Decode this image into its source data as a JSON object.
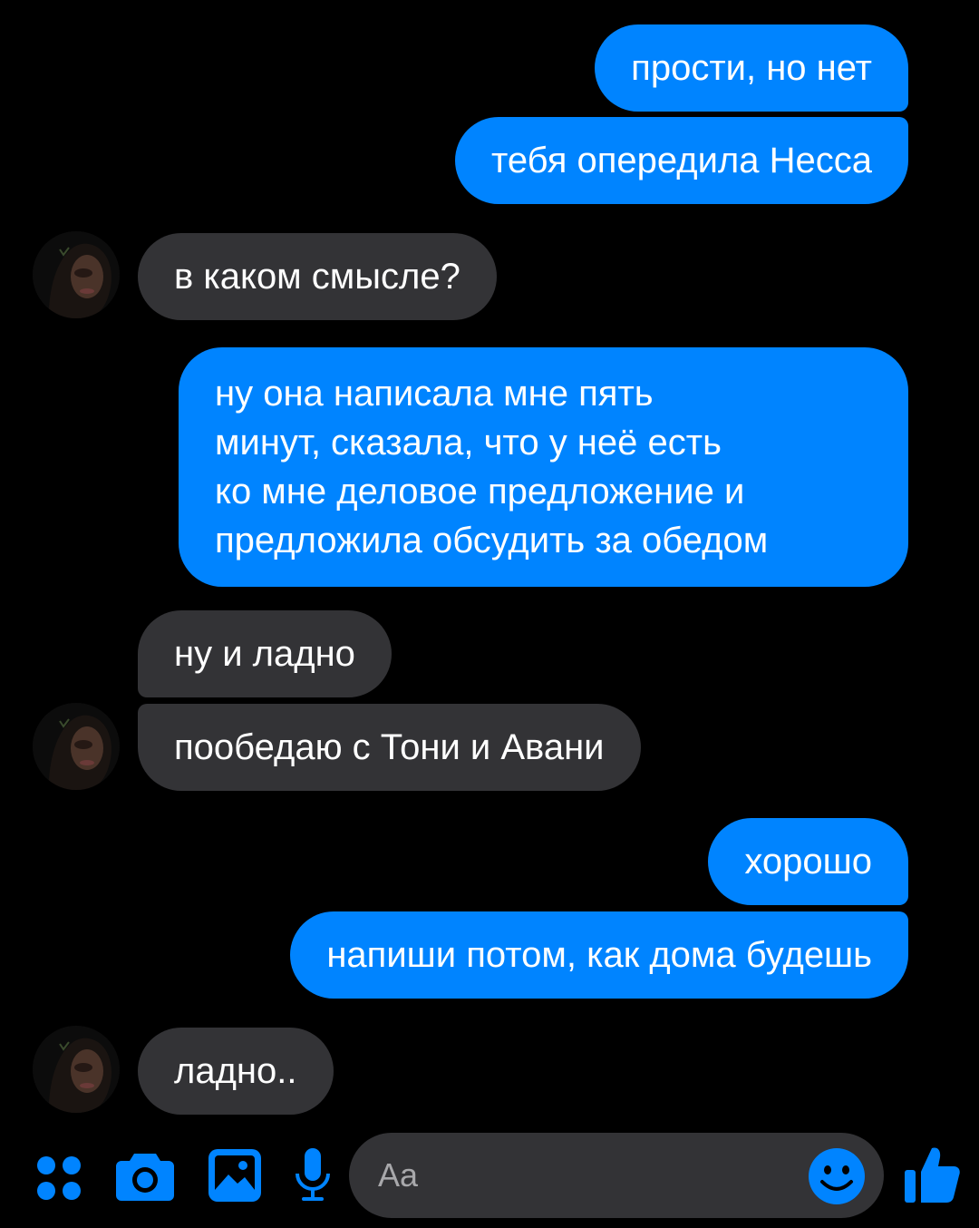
{
  "messages": [
    {
      "id": "m1",
      "direction": "outgoing",
      "text": "прости, но нет"
    },
    {
      "id": "m2",
      "direction": "outgoing",
      "text": "тебя опередила Несса"
    },
    {
      "id": "m3",
      "direction": "incoming",
      "text": "в каком смысле?"
    },
    {
      "id": "m4",
      "direction": "outgoing",
      "lines": [
        "ну она написала мне пять",
        "минут, сказала, что у неё есть",
        "ко мне деловое предложение и",
        "предложила обсудить за обедом"
      ]
    },
    {
      "id": "m5",
      "direction": "incoming",
      "text": "ну и ладно"
    },
    {
      "id": "m6",
      "direction": "incoming",
      "text": "пообедаю с Тони и Авани"
    },
    {
      "id": "m7",
      "direction": "outgoing",
      "text": "хорошо"
    },
    {
      "id": "m8",
      "direction": "outgoing",
      "text": "напиши потом, как дома будешь"
    },
    {
      "id": "m9",
      "direction": "incoming",
      "text": "ладно.."
    }
  ],
  "composer": {
    "placeholder": "Aa",
    "icons": [
      "more-actions-icon",
      "camera-icon",
      "gallery-icon",
      "microphone-icon",
      "emoji-icon",
      "thumbs-up-icon"
    ]
  },
  "colors": {
    "background": "#000000",
    "outgoing_bubble": "#0084ff",
    "incoming_bubble": "#333336",
    "accent": "#0084ff",
    "composer_bg": "#333336",
    "placeholder": "#a8a8ab"
  }
}
